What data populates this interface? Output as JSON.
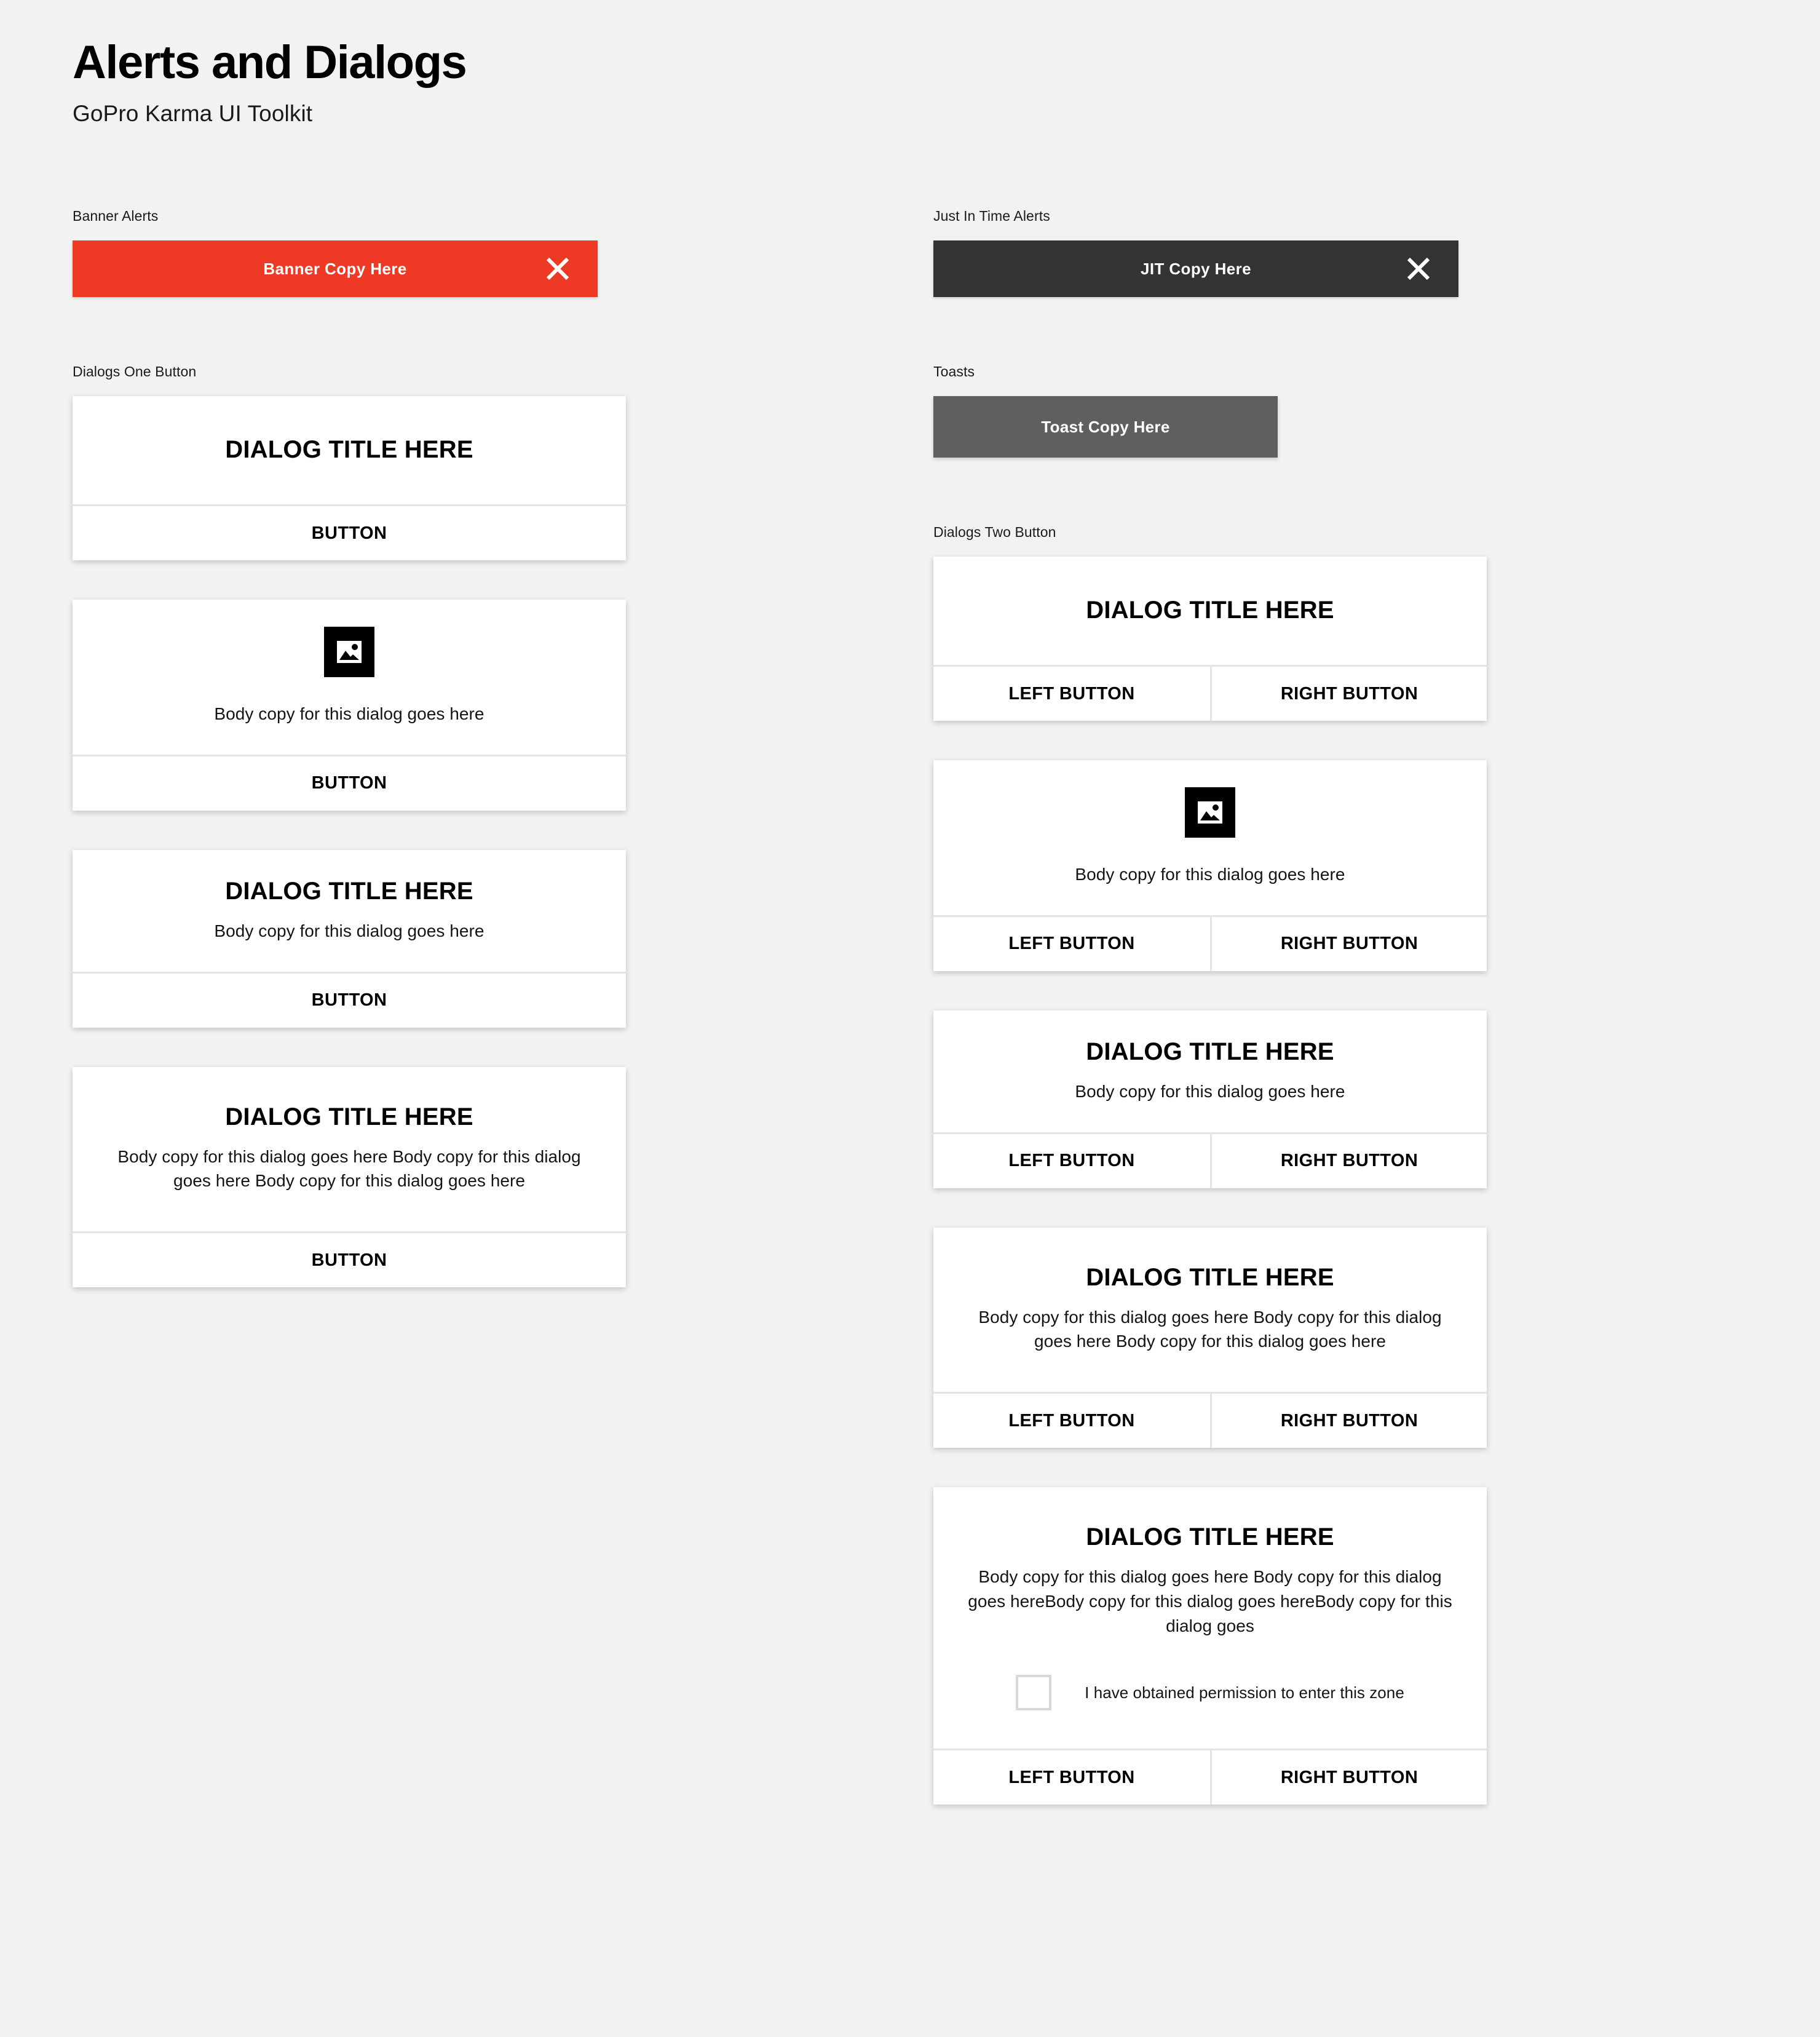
{
  "header": {
    "title": "Alerts and Dialogs",
    "subtitle": "GoPro Karma UI Toolkit"
  },
  "colors": {
    "background": "#F2F2F2",
    "banner_red": "#EE3A24",
    "jit_dark": "#333333",
    "toast_gray": "#5F5F5F",
    "card_white": "#FFFFFF",
    "divider": "#E4E4E4",
    "checkbox_border": "#D8D8D8",
    "text_black": "#000000"
  },
  "left_column": {
    "banner_alerts": {
      "label": "Banner Alerts",
      "copy": "Banner Copy Here",
      "close_icon": "close-icon"
    },
    "dialogs_one_button": {
      "label": "Dialogs One Button",
      "dialogs": [
        {
          "title": "DIALOG TITLE HERE",
          "body": "",
          "image_icon": "",
          "button": "BUTTON"
        },
        {
          "title": "",
          "body": "Body copy for this dialog goes here",
          "image_icon": "image-placeholder-icon",
          "button": "BUTTON"
        },
        {
          "title": "DIALOG TITLE HERE",
          "body": "Body copy for this dialog goes here",
          "image_icon": "",
          "button": "BUTTON"
        },
        {
          "title": "DIALOG TITLE HERE",
          "body": "Body copy for this dialog goes here Body copy for this dialog goes here Body copy for this dialog goes here",
          "image_icon": "",
          "button": "BUTTON"
        }
      ]
    }
  },
  "right_column": {
    "jit_alerts": {
      "label": "Just In Time Alerts",
      "copy": "JIT Copy Here",
      "close_icon": "close-icon"
    },
    "toasts": {
      "label": "Toasts",
      "copy": "Toast Copy Here"
    },
    "dialogs_two_button": {
      "label": "Dialogs Two Button",
      "dialogs": [
        {
          "title": "DIALOG TITLE HERE",
          "body": "",
          "image_icon": "",
          "checkbox_label": "",
          "left_button": "LEFT BUTTON",
          "right_button": "RIGHT BUTTON"
        },
        {
          "title": "",
          "body": "Body copy for this dialog goes here",
          "image_icon": "image-placeholder-icon",
          "checkbox_label": "",
          "left_button": "LEFT BUTTON",
          "right_button": "RIGHT BUTTON"
        },
        {
          "title": "DIALOG TITLE HERE",
          "body": "Body copy for this dialog goes here",
          "image_icon": "",
          "checkbox_label": "",
          "left_button": "LEFT BUTTON",
          "right_button": "RIGHT BUTTON"
        },
        {
          "title": "DIALOG TITLE HERE",
          "body": "Body copy for this dialog goes here Body copy for this dialog goes here Body copy for this dialog goes here",
          "image_icon": "",
          "checkbox_label": "",
          "left_button": "LEFT BUTTON",
          "right_button": "RIGHT BUTTON"
        },
        {
          "title": "DIALOG TITLE HERE",
          "body": "Body copy for this dialog goes here Body copy for this dialog goes hereBody copy for this dialog goes hereBody copy for this dialog goes",
          "image_icon": "",
          "checkbox_label": "I have obtained permission to enter this zone",
          "left_button": "LEFT BUTTON",
          "right_button": "RIGHT BUTTON"
        }
      ]
    }
  }
}
